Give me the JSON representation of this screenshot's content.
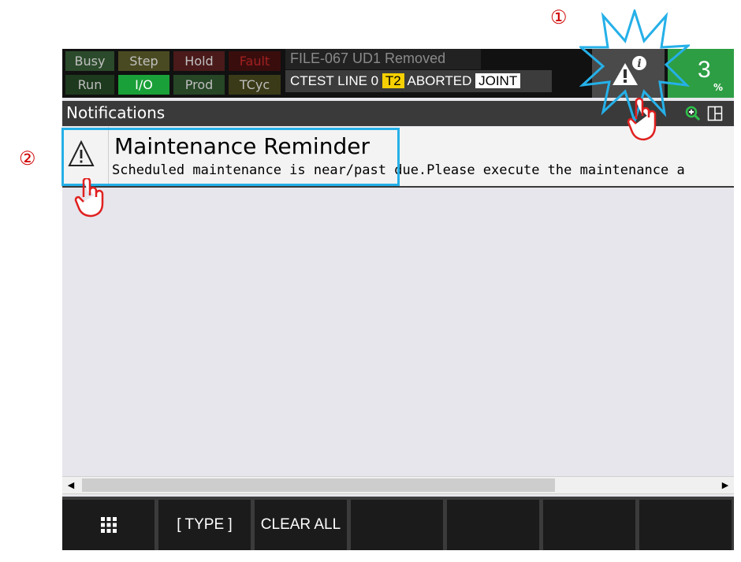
{
  "callouts": {
    "one": "①",
    "two": "②"
  },
  "status": {
    "lamps": [
      {
        "label": "Busy",
        "bg": "#2b4a2b",
        "fg": "#c0c0c0"
      },
      {
        "label": "Step",
        "bg": "#4a4a22",
        "fg": "#c0c0c0"
      },
      {
        "label": "Hold",
        "bg": "#4a1a1a",
        "fg": "#c0c0c0"
      },
      {
        "label": "Fault",
        "bg": "#3a0d0d",
        "fg": "#a02020"
      },
      {
        "label": "Run",
        "bg": "#1e3a1e",
        "fg": "#bdbdbd"
      },
      {
        "label": "I/O",
        "bg": "#1aa038",
        "fg": "#ffffff"
      },
      {
        "label": "Prod",
        "bg": "#264626",
        "fg": "#bdbdbd"
      },
      {
        "label": "TCyc",
        "bg": "#3a3a18",
        "fg": "#bdbdbd"
      }
    ],
    "message_top": "FILE-067 UD1 Removed",
    "message_bottom": {
      "prog": "CTEST LINE 0",
      "mode": "T2",
      "state": "ABORTED",
      "coord": "JOINT"
    },
    "override_value": "3",
    "override_unit": "%"
  },
  "title": "Notifications",
  "icons": {
    "alert": "alert-info-icon",
    "zoom": "zoom-in-icon",
    "layout": "layout-icon",
    "warning": "warning-triangle-icon",
    "menu": "grid-menu-icon"
  },
  "notifications": [
    {
      "title": "Maintenance Reminder",
      "description": "Scheduled maintenance is near/past due.Please execute the maintenance a"
    }
  ],
  "fkeys": [
    "",
    "[ TYPE ]",
    "CLEAR ALL",
    "",
    "",
    "",
    ""
  ],
  "colors": {
    "callout_border": "#25b0e8",
    "callout_number": "#d00000",
    "hand": "#e02020",
    "override_bg": "#2e9e44"
  }
}
